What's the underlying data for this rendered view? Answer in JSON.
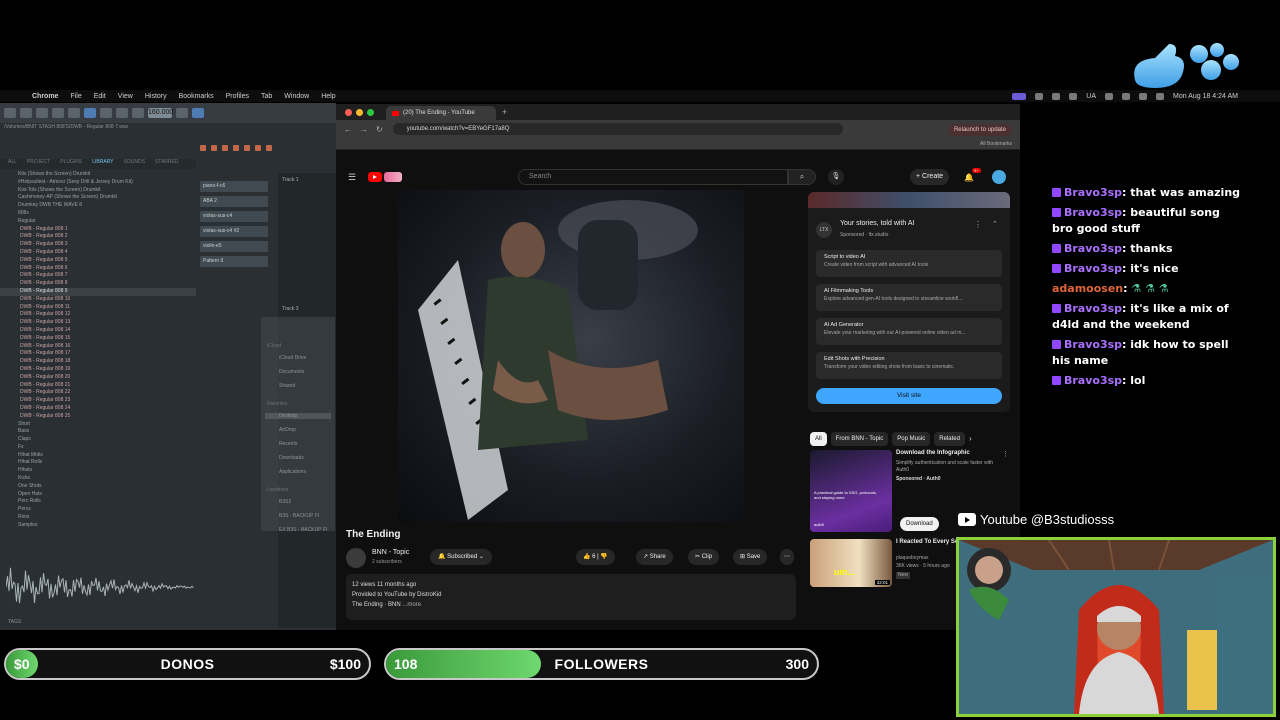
{
  "menubar": {
    "items": [
      "Chrome",
      "File",
      "Edit",
      "View",
      "History",
      "Bookmarks",
      "Profiles",
      "Tab",
      "Window",
      "Help"
    ],
    "status": {
      "input": "UA",
      "time": "Mon Aug 18  4:24 AM"
    }
  },
  "fl": {
    "tempo": "160.000",
    "path": "/Volumes/BNIT STASH 808'S/DWB - Regular 808 7.wav",
    "browser_tabs": [
      "ALL",
      "PROJECT",
      "PLUGINS",
      "LIBRARY",
      "SOUNDS",
      "STARRED"
    ],
    "browser_rows": [
      {
        "label": "Kits (Shows the Screen) Drumkit",
        "type": "fold"
      },
      {
        "label": "#Helpsuilest - Atmosr (Sexy Drill & Jersey Drum Kit)",
        "type": "fold"
      },
      {
        "label": "Kisi-Tols (Shows the Screen) Drumkit",
        "type": "fold"
      },
      {
        "label": "Cashmoney-AP (Shows the Screen) Drumkit",
        "type": "fold"
      },
      {
        "label": "Drumkey DWB THE WAVE 8",
        "type": "fold"
      },
      {
        "label": "808s",
        "type": "fold"
      },
      {
        "label": "Regular",
        "type": "fold"
      },
      {
        "label": "DWB - Regular 808 1",
        "type": "file"
      },
      {
        "label": "DWB - Regular 808 2",
        "type": "file"
      },
      {
        "label": "DWB - Regular 808 3",
        "type": "file"
      },
      {
        "label": "DWB - Regular 808 4",
        "type": "file"
      },
      {
        "label": "DWB - Regular 808 5",
        "type": "file"
      },
      {
        "label": "DWB - Regular 808 6",
        "type": "file"
      },
      {
        "label": "DWB - Regular 808 7",
        "type": "file"
      },
      {
        "label": "DWB - Regular 808 8",
        "type": "file"
      },
      {
        "label": "DWB - Regular 808 9",
        "type": "hl"
      },
      {
        "label": "DWB - Regular 808 10",
        "type": "file"
      },
      {
        "label": "DWB - Regular 808 11",
        "type": "file"
      },
      {
        "label": "DWB - Regular 808 12",
        "type": "file"
      },
      {
        "label": "DWB - Regular 808 13",
        "type": "file"
      },
      {
        "label": "DWB - Regular 808 14",
        "type": "file"
      },
      {
        "label": "DWB - Regular 808 15",
        "type": "file"
      },
      {
        "label": "DWB - Regular 808 16",
        "type": "file"
      },
      {
        "label": "DWB - Regular 808 17",
        "type": "file"
      },
      {
        "label": "DWB - Regular 808 18",
        "type": "file"
      },
      {
        "label": "DWB - Regular 808 19",
        "type": "file"
      },
      {
        "label": "DWB - Regular 808 20",
        "type": "file"
      },
      {
        "label": "DWB - Regular 808 21",
        "type": "file"
      },
      {
        "label": "DWB - Regular 808 22",
        "type": "file"
      },
      {
        "label": "DWB - Regular 808 23",
        "type": "file"
      },
      {
        "label": "DWB - Regular 808 24",
        "type": "file"
      },
      {
        "label": "DWB - Regular 808 25",
        "type": "file"
      },
      {
        "label": "Short",
        "type": "fold"
      },
      {
        "label": "Bass",
        "type": "fold"
      },
      {
        "label": "Claps",
        "type": "fold"
      },
      {
        "label": "Fx",
        "type": "fold"
      },
      {
        "label": "Hihat Midis",
        "type": "fold"
      },
      {
        "label": "Hihat Rolls",
        "type": "fold"
      },
      {
        "label": "Hihats",
        "type": "fold"
      },
      {
        "label": "Kicks",
        "type": "fold"
      },
      {
        "label": "One Shots",
        "type": "fold"
      },
      {
        "label": "Open Hats",
        "type": "fold"
      },
      {
        "label": "Perc Rolls",
        "type": "fold"
      },
      {
        "label": "Percs",
        "type": "fold"
      },
      {
        "label": "Rims",
        "type": "fold"
      },
      {
        "label": "Samples",
        "type": "fold"
      }
    ],
    "tags_label": "TAGS",
    "channels": [
      "piano-f-c6",
      "ABA 2",
      "violas-sus-c4",
      "violas-sus-c4 #2",
      "violin-e5",
      "Pattern 9"
    ],
    "tracks": [
      "Track 1",
      "Track 3"
    ]
  },
  "finder": {
    "sections": [
      {
        "head": "iCloud",
        "items": [
          "iCloud Drive",
          "Documents",
          "Shared"
        ]
      },
      {
        "head": "Favorites",
        "items": [
          "Desktop",
          "AirDrop",
          "Recents",
          "Downloads",
          "Applications"
        ]
      },
      {
        "head": "Locations",
        "items": [
          "B3S2",
          "B3S - BACKUP FI",
          "EX B3S - BACKUP FI"
        ]
      }
    ],
    "selected": "Desktop"
  },
  "chrome": {
    "tab_title": "(20) The Ending - YouTube",
    "url": "youtube.com/watch?v=EBYeGF17a8Q",
    "relaunch": "Relaunch to update",
    "bookmarks": "All Bookmarks"
  },
  "youtube": {
    "search_placeholder": "Search",
    "create": "Create",
    "notifications": "9+",
    "video_title": "The Ending",
    "channel": {
      "name": "BNN - Topic",
      "subs": "2 subscribers"
    },
    "subscribed": "Subscribed",
    "likes": "6",
    "actions": [
      "Share",
      "Clip",
      "Save"
    ],
    "desc": {
      "meta": "12 views  11 months ago",
      "line": "Provided to YouTube by DistroKid",
      "more_prefix": "The Ending · BNN",
      "more": "...more"
    },
    "ad": {
      "head": "Your stories, told with AI",
      "sponsor": "Sponsored · ltx.studio",
      "logo": "LTX",
      "items": [
        {
          "title": "Script to video AI",
          "desc": "Create video from script with advanced AI tools"
        },
        {
          "title": "AI Filmmaking Tools",
          "desc": "Explore advanced gen-AI tools designed to streamline workfl..."
        },
        {
          "title": "AI Ad Generator",
          "desc": "Elevate your marketing with our AI-powered online video ad m..."
        },
        {
          "title": "Edit Shots with Precision",
          "desc": "Transform your video editing shots from basic to cinematic."
        }
      ],
      "visit": "Visit site"
    },
    "chips": [
      "All",
      "From BNN - Topic",
      "Pop Music",
      "Related"
    ],
    "recs": [
      {
        "title": "Download the Infographic",
        "desc": "Simplify authentication and scale faster with Auth0",
        "meta": "Sponsored · Auth0",
        "button": "Download",
        "thumb_caption": "A practical guide to SSO, protocols, and staying none",
        "brand": "auth0"
      },
      {
        "title": "I Reacted To Every Song..",
        "desc": "plaqueboymax",
        "meta": "36K views · 5 hours ago",
        "badge": "New",
        "duration": "32:01",
        "thumb_text": "um..."
      }
    ]
  },
  "chat": [
    {
      "user": "Bravo3sp",
      "text": "that was amazing"
    },
    {
      "user": "Bravo3sp",
      "text": "beautiful song bro good stuff"
    },
    {
      "user": "Bravo3sp",
      "text": "thanks"
    },
    {
      "user": "Bravo3sp",
      "text": "it's nice"
    },
    {
      "user": "adamoosen",
      "text": "",
      "emotes": "⚗ ⚗ ⚗"
    },
    {
      "user": "Bravo3sp",
      "text": "it's like a mix of d4ld and the weekend"
    },
    {
      "user": "Bravo3sp",
      "text": "idk how to spell his name"
    },
    {
      "user": "Bravo3sp",
      "text": "lol"
    }
  ],
  "stream": {
    "youtube_handle": "Youtube @B3studiosss",
    "donos": {
      "label": "DONOS",
      "current": "$0",
      "goal": "$100",
      "fraction": 0.0
    },
    "followers": {
      "label": "FOLLOWERS",
      "current": "108",
      "goal": "300",
      "fraction": 0.36
    }
  },
  "colors": {
    "accent_green": "#8bd13a",
    "yt_red": "#ff0000",
    "twitch_purple": "#9146ff",
    "link_blue": "#3ea6ff"
  }
}
